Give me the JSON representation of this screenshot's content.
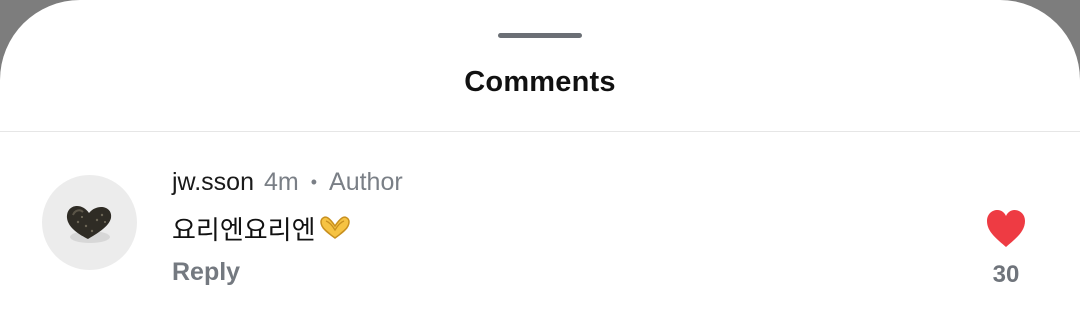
{
  "sheet": {
    "title": "Comments"
  },
  "comment": {
    "username": "jw.sson",
    "time": "4m",
    "separator": "•",
    "badge": "Author",
    "text": "요리엔요리엔",
    "emoji_icon": "heart-hands-icon",
    "reply_label": "Reply",
    "like_icon": "heart-icon",
    "like_count": "30",
    "liked": true
  },
  "colors": {
    "like_red": "#ee3b43",
    "muted_text": "#7a7f86",
    "backdrop": "#7d7d7d"
  }
}
